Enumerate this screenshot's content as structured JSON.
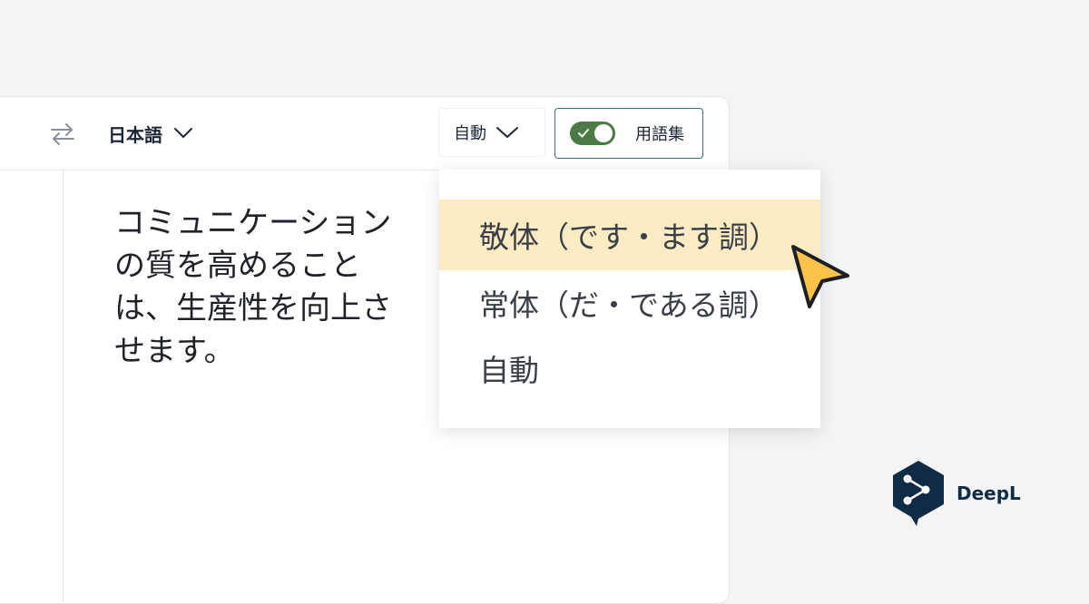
{
  "toolbar": {
    "target_language": "日本語",
    "formality_selected": "自動",
    "glossary_label": "用語集",
    "glossary_enabled": true
  },
  "translation": {
    "text": "コミュニケーションの質を高めることは、生産性を向上させます。",
    "lines": [
      "コミュニケーション",
      "の質を高めること",
      "は、生産性を向上さ",
      "せます。"
    ]
  },
  "formality_menu": {
    "options": [
      {
        "label": "敬体（です・ます調）",
        "highlighted": true
      },
      {
        "label": "常体（だ・である調）",
        "highlighted": false
      },
      {
        "label": "自動",
        "highlighted": false
      }
    ]
  },
  "brand": {
    "name": "DeepL"
  },
  "colors": {
    "highlight": "#fdebc4",
    "toggle_on": "#4b7a45",
    "cursor": "#fcc24a",
    "brand": "#0f2b46"
  },
  "icons": [
    "swap-arrows-icon",
    "chevron-down-icon",
    "check-icon",
    "cursor-arrow-icon",
    "deepl-logo-icon"
  ]
}
